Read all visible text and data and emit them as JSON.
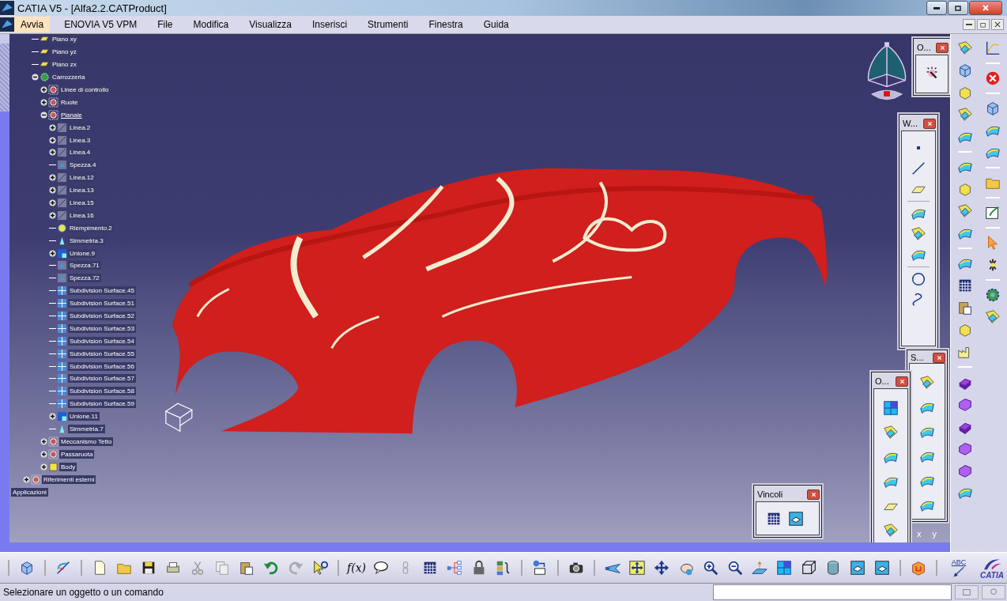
{
  "window": {
    "title": "CATIA V5 - [Alfa2.2.CATProduct]"
  },
  "menu": [
    {
      "label": "Avvia",
      "selected": true
    },
    {
      "label": "ENOVIA V5 VPM",
      "selected": false
    },
    {
      "label": "File",
      "selected": false
    },
    {
      "label": "Modifica",
      "selected": false
    },
    {
      "label": "Visualizza",
      "selected": false
    },
    {
      "label": "Inserisci",
      "selected": false
    },
    {
      "label": "Strumenti",
      "selected": false
    },
    {
      "label": "Finestra",
      "selected": false
    },
    {
      "label": "Guida",
      "selected": false
    }
  ],
  "tree": {
    "items": [
      {
        "label": "Piano xy",
        "kind": "plane",
        "selected": false
      },
      {
        "label": "Piano yz",
        "kind": "plane",
        "selected": false
      },
      {
        "label": "Piano zx",
        "kind": "plane",
        "selected": false
      },
      {
        "label": "Carrozzeria",
        "kind": "product",
        "expanded": true,
        "selected": false,
        "children": [
          {
            "label": "Linee di controllo",
            "kind": "set",
            "expanded": false,
            "selected": false
          },
          {
            "label": "Ruote",
            "kind": "set",
            "expanded": false,
            "selected": false
          },
          {
            "label": "Pianale",
            "kind": "set",
            "expanded": true,
            "selected": true,
            "children": [
              {
                "label": "Linea.2",
                "kind": "line",
                "expanded": false,
                "selected": false
              },
              {
                "label": "Linea.3",
                "kind": "line",
                "expanded": false,
                "selected": false
              },
              {
                "label": "Linea.4",
                "kind": "line",
                "expanded": false,
                "selected": false
              },
              {
                "label": "Spezza.4",
                "kind": "split",
                "selected": false
              },
              {
                "label": "Linea.12",
                "kind": "line",
                "expanded": false,
                "selected": false
              },
              {
                "label": "Linea.13",
                "kind": "line",
                "expanded": false,
                "selected": false
              },
              {
                "label": "Linea.15",
                "kind": "line",
                "expanded": false,
                "selected": false
              },
              {
                "label": "Linea.16",
                "kind": "line",
                "expanded": false,
                "selected": false
              },
              {
                "label": "Riempimento.2",
                "kind": "fill",
                "selected": false
              },
              {
                "label": "Simmetria.3",
                "kind": "symmetry",
                "selected": false
              },
              {
                "label": "Unione.9",
                "kind": "join",
                "expanded": false,
                "selected": false
              },
              {
                "label": "Spezza.71",
                "kind": "split",
                "selected": false
              },
              {
                "label": "Spezza.72",
                "kind": "split",
                "selected": false
              },
              {
                "label": "Subdivision Surface.45",
                "kind": "subdivision",
                "selected": false
              },
              {
                "label": "Subdivision Surface.51",
                "kind": "subdivision",
                "selected": false
              },
              {
                "label": "Subdivision Surface.52",
                "kind": "subdivision",
                "selected": false
              },
              {
                "label": "Subdivision Surface.53",
                "kind": "subdivision",
                "selected": false
              },
              {
                "label": "Subdivision Surface.54",
                "kind": "subdivision",
                "selected": false
              },
              {
                "label": "Subdivision Surface.55",
                "kind": "subdivision",
                "selected": false
              },
              {
                "label": "Subdivision Surface.56",
                "kind": "subdivision",
                "selected": false
              },
              {
                "label": "Subdivision Surface.57",
                "kind": "subdivision",
                "selected": false
              },
              {
                "label": "Subdivision Surface.58",
                "kind": "subdivision",
                "selected": false
              },
              {
                "label": "Subdivision Surface.59",
                "kind": "subdivision",
                "selected": false
              },
              {
                "label": "Unione.11",
                "kind": "join",
                "expanded": false,
                "selected": false
              },
              {
                "label": "Simmetria.7",
                "kind": "symmetry",
                "selected": false
              }
            ]
          },
          {
            "label": "Meccanismo Tetto",
            "kind": "set",
            "expanded": false,
            "selected": false
          },
          {
            "label": "Passaruota",
            "kind": "set",
            "expanded": false,
            "selected": false
          },
          {
            "label": "Body",
            "kind": "body",
            "expanded": false,
            "selected": false
          }
        ]
      }
    ],
    "outer_items": [
      {
        "label": "Riferimenti esterni",
        "kind": "set",
        "expanded": false,
        "selected": false
      }
    ],
    "root_items": [
      {
        "label": "Applicazioni"
      }
    ]
  },
  "floating_toolbars": [
    {
      "title": "O..."
    },
    {
      "title": "W..."
    },
    {
      "title": "S..."
    },
    {
      "title": "O..."
    },
    {
      "title": "Vincoli"
    }
  ],
  "axis_labels": [
    "x",
    "y"
  ],
  "bottom_toolbar": {
    "formula_label": "f(x)",
    "annotation_label": "ABC"
  },
  "logo": {
    "text": "CATIA"
  },
  "status_bar": {
    "message": "Selezionare un oggetto o un comando"
  }
}
